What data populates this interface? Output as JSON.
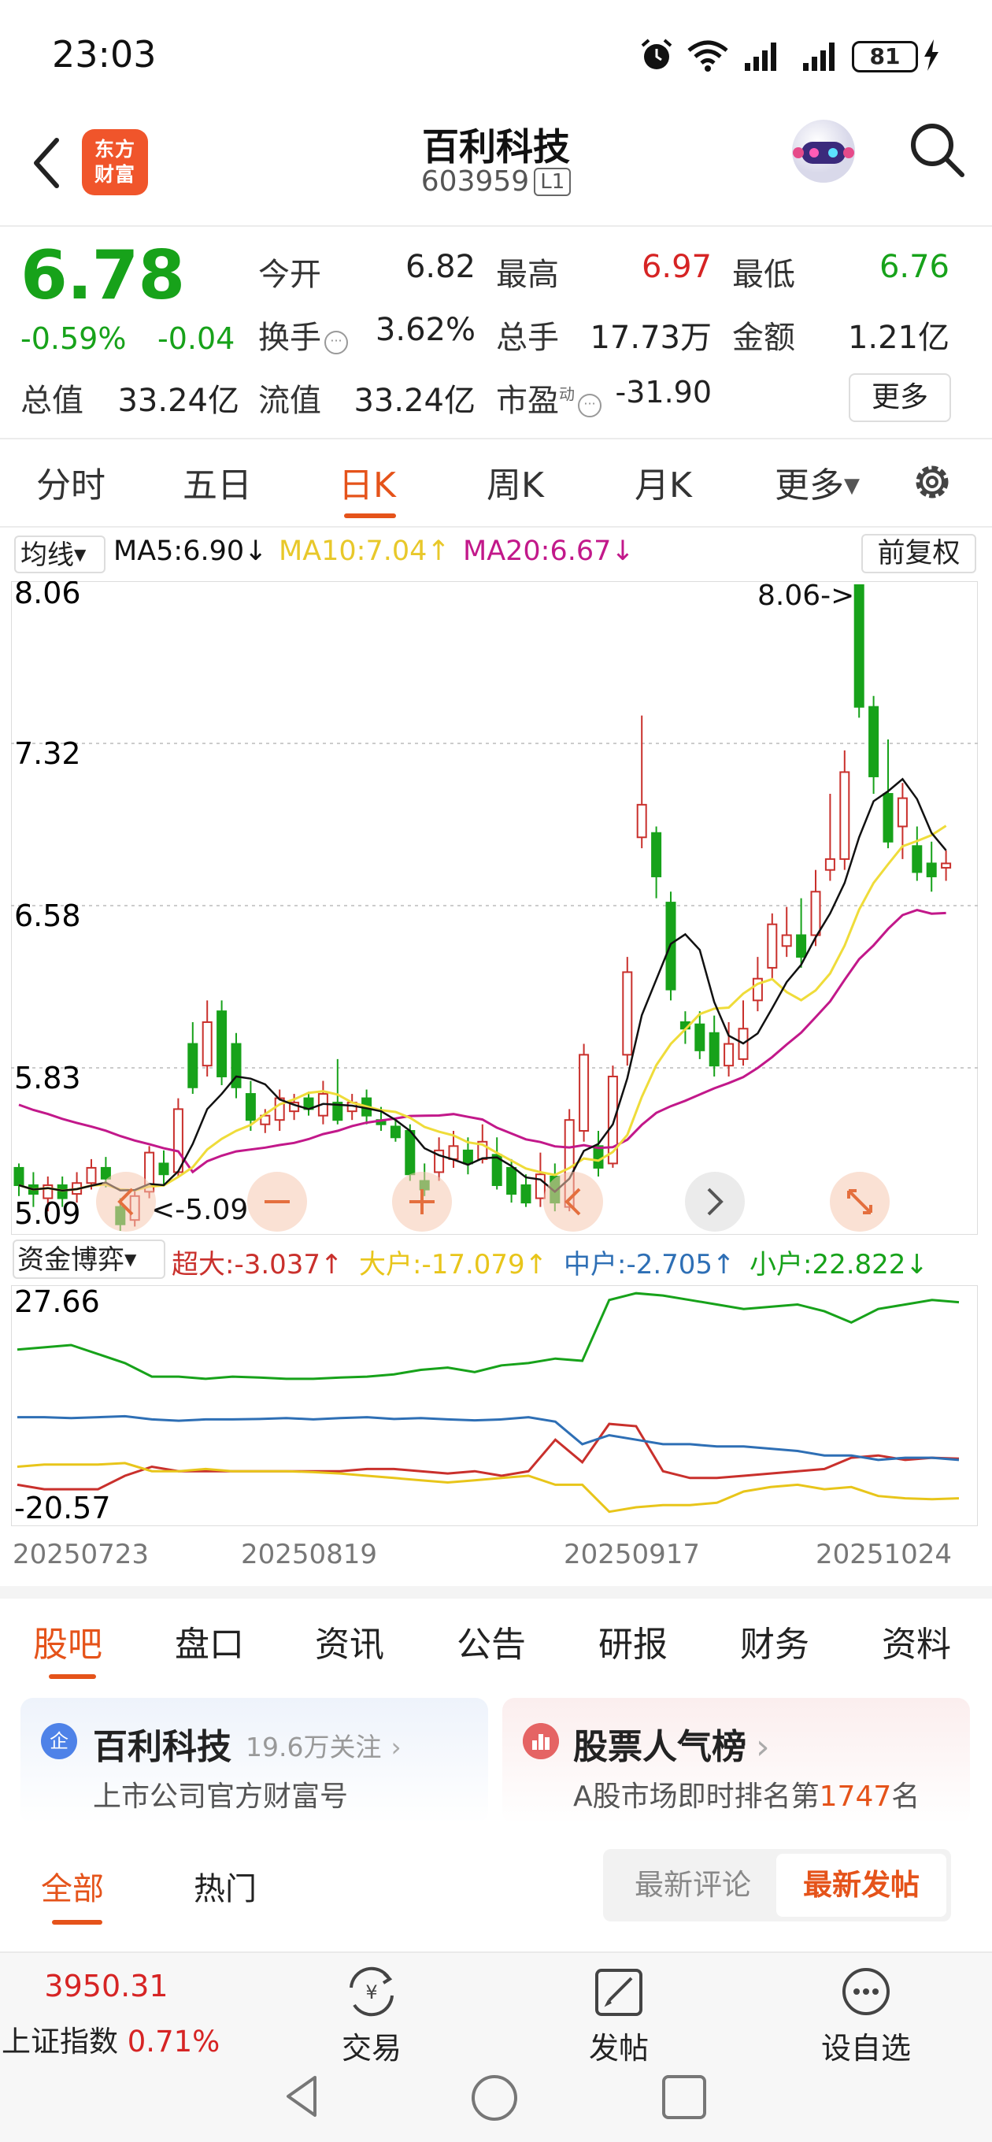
{
  "status_bar": {
    "time": "23:03",
    "battery": "81"
  },
  "header": {
    "title": "百利科技",
    "code": "603959",
    "level": "L1",
    "logo_text_1": "东方",
    "logo_text_2": "财富"
  },
  "quote": {
    "price": "6.78",
    "change_pct": "-0.59%",
    "change_abs": "-0.04",
    "open_label": "今开",
    "open": "6.82",
    "high_label": "最高",
    "high": "6.97",
    "low_label": "最低",
    "low": "6.76",
    "turnover_label": "换手",
    "turnover": "3.62%",
    "volume_label": "总手",
    "volume": "17.73万",
    "amount_label": "金额",
    "amount": "1.21亿",
    "mcap_label": "总值",
    "mcap": "33.24亿",
    "float_label": "流值",
    "float": "33.24亿",
    "pe_label": "市盈",
    "pe_sup": "动",
    "pe": "-31.90",
    "more": "更多"
  },
  "period_tabs": [
    "分时",
    "五日",
    "日K",
    "周K",
    "月K",
    "更多"
  ],
  "ma": {
    "dropdown": "均线",
    "ma5": "MA5:6.90↓",
    "ma10": "MA10:7.04↑",
    "ma20": "MA20:6.67↓",
    "adjust": "前复权"
  },
  "chart_data": [
    {
      "type": "candlestick",
      "y_ticks": [
        "8.06",
        "7.32",
        "6.58",
        "5.83",
        "5.09"
      ],
      "ylim": [
        5.09,
        8.06
      ],
      "max_label": "8.06->",
      "min_label": "<-5.09",
      "legend": [
        "MA5",
        "MA10",
        "MA20"
      ],
      "colors": {
        "up": "#c9302c",
        "down": "#17a21a",
        "ma5": "#111111",
        "ma10": "#efdc3a",
        "ma20": "#c2188a"
      }
    },
    {
      "type": "line",
      "title": "资金博弈",
      "y_ticks": [
        "27.66",
        "-20.57"
      ],
      "ylim": [
        -20.57,
        27.66
      ],
      "x_ticks": [
        "20250723",
        "20250819",
        "20250917",
        "20251024"
      ],
      "series": [
        {
          "name": "超大",
          "label": "超大:-3.037↑",
          "color": "#c9302c"
        },
        {
          "name": "大户",
          "label": "大户:-17.079↑",
          "color": "#e8c51a"
        },
        {
          "name": "中户",
          "label": "中户:-2.705↑",
          "color": "#2e6fb5"
        },
        {
          "name": "小户",
          "label": "小户:22.822↓",
          "color": "#17a21a"
        }
      ]
    }
  ],
  "sub_tabs": [
    "股吧",
    "盘口",
    "资讯",
    "公告",
    "研报",
    "财务",
    "资料"
  ],
  "company_card": {
    "badge": "企",
    "name": "百利科技",
    "follow": "19.6万关注",
    "sub": "上市公司官方财富号"
  },
  "rank_card": {
    "title": "股票人气榜",
    "sub_prefix": "A股市场即时排名第",
    "rank": "1747",
    "sub_suffix": "名"
  },
  "feed": {
    "all": "全部",
    "hot": "热门",
    "sort_comment": "最新评论",
    "sort_post": "最新发帖"
  },
  "bottom_bar": {
    "index_value": "3950.31",
    "index_name": "上证指数",
    "index_pct": "0.71%",
    "trade": "交易",
    "post": "发帖",
    "watch": "设自选"
  }
}
